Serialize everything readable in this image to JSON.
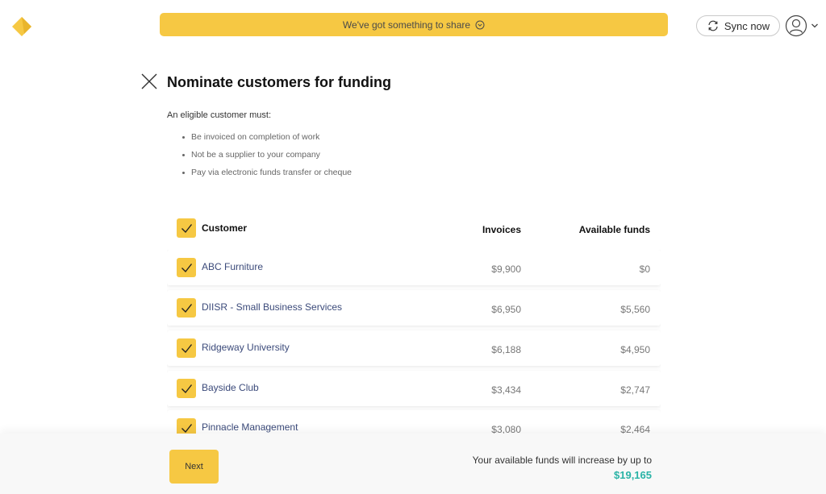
{
  "header": {
    "logo_icon": "diamond-logo-icon",
    "banner_label": "We've got something to share",
    "banner_icon": "chevron-circle-down-icon",
    "sync_label": "Sync now",
    "sync_icon": "refresh-icon",
    "avatar_icon": "user-avatar-icon"
  },
  "page": {
    "title": "Nominate customers for funding",
    "close_icon": "close-icon",
    "criteria_heading": "An eligible customer must:",
    "criteria": [
      "Be invoiced on completion of work",
      "Not be a supplier to your company",
      "Pay via electronic funds transfer or cheque"
    ]
  },
  "table": {
    "columns": {
      "customer": "Customer",
      "invoices": "Invoices",
      "funds": "Available funds"
    },
    "rows": [
      {
        "name": "ABC Furniture",
        "invoices": "$9,900",
        "funds": "$0",
        "checked": true
      },
      {
        "name": "DIISR - Small Business Services",
        "invoices": "$6,950",
        "funds": "$5,560",
        "checked": true
      },
      {
        "name": "Ridgeway University",
        "invoices": "$6,188",
        "funds": "$4,950",
        "checked": true
      },
      {
        "name": "Bayside Club",
        "invoices": "$3,434",
        "funds": "$2,747",
        "checked": true
      },
      {
        "name": "Pinnacle Management",
        "invoices": "$3,080",
        "funds": "$2,464",
        "checked": true
      }
    ]
  },
  "footer": {
    "next_label": "Next",
    "message": "Your available funds will increase by up to",
    "amount": "$19,165"
  },
  "colors": {
    "accent": "#f6c843",
    "amount": "#2ab3a6",
    "customer_name": "#3b4a7a"
  }
}
